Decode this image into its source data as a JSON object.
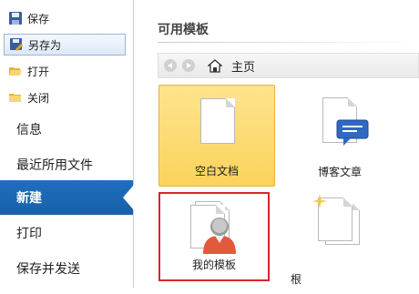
{
  "sidebar": {
    "top_items": [
      {
        "label": "保存",
        "icon": "save-icon"
      },
      {
        "label": "另存为",
        "icon": "save-as-icon"
      },
      {
        "label": "打开",
        "icon": "open-folder-icon"
      },
      {
        "label": "关闭",
        "icon": "close-folder-icon"
      }
    ],
    "selected_top": "另存为",
    "items": [
      {
        "label": "信息"
      },
      {
        "label": "最近所用文件"
      },
      {
        "label": "新建"
      },
      {
        "label": "打印"
      },
      {
        "label": "保存并发送"
      }
    ],
    "active_item": "新建"
  },
  "main": {
    "section_title": "可用模板",
    "breadcrumb": "主页",
    "templates": [
      {
        "label": "空白文档",
        "icon": "blank-document-icon",
        "state": "selected"
      },
      {
        "label": "博客文章",
        "icon": "blog-post-icon",
        "state": "normal"
      },
      {
        "label": "我的模板",
        "icon": "my-templates-icon",
        "state": "highlighted"
      },
      {
        "label": "根",
        "icon": "new-from-existing-icon",
        "state": "normal"
      }
    ]
  },
  "colors": {
    "accent": "#1e6fbf",
    "selected_tile": "#fbd35c",
    "highlight_border": "#d4262b"
  }
}
